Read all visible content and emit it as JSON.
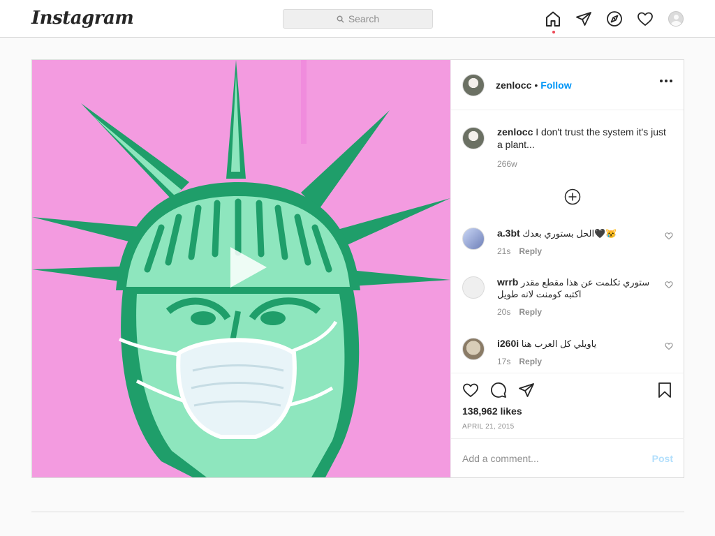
{
  "nav": {
    "logo": "Instagram",
    "search_placeholder": "Search",
    "icons": [
      "home-icon",
      "direct-icon",
      "explore-icon",
      "activity-icon",
      "profile-avatar"
    ]
  },
  "post": {
    "author": "zenlocc",
    "follow_label": "Follow",
    "separator": "•",
    "caption_user": "zenlocc",
    "caption_text": " I don't trust the system it's just a plant...",
    "caption_time": "266w",
    "comments": [
      {
        "user": "a.3bt",
        "text": " الحل بستوري بعدك🖤😿",
        "time": "21s",
        "reply": "Reply"
      },
      {
        "user": "wrrb",
        "text": " ستوري تكلمت عن هذا مقطع مقدر اكتبه كومنت لانه طويل",
        "time": "20s",
        "reply": "Reply"
      },
      {
        "user": "i260i",
        "text": " ياويلي كل العرب هنا",
        "time": "17s",
        "reply": "Reply"
      }
    ],
    "likes": "138,962 likes",
    "date": "APRIL 21, 2015",
    "add_comment_placeholder": "Add a comment...",
    "post_label": "Post"
  },
  "colors": {
    "accent": "#0095f6",
    "media_background": "#f39be0",
    "statue_green": "#1f9e6a",
    "statue_light": "#8ee6be"
  }
}
